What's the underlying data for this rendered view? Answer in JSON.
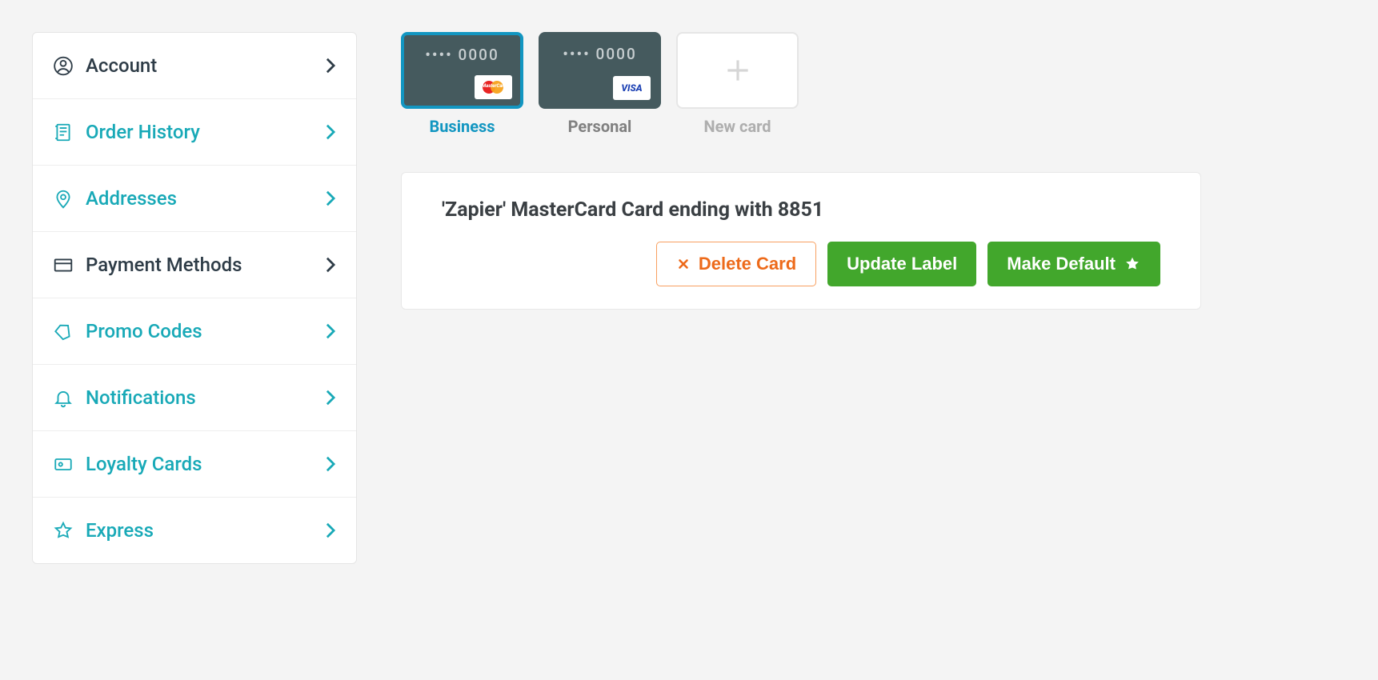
{
  "sidebar": {
    "items": [
      {
        "label": "Account",
        "icon": "user-icon",
        "style": "dark"
      },
      {
        "label": "Order History",
        "icon": "receipt-icon",
        "style": "teal"
      },
      {
        "label": "Addresses",
        "icon": "pin-icon",
        "style": "teal"
      },
      {
        "label": "Payment Methods",
        "icon": "card-icon",
        "style": "dark"
      },
      {
        "label": "Promo Codes",
        "icon": "ticket-icon",
        "style": "teal"
      },
      {
        "label": "Notifications",
        "icon": "bell-icon",
        "style": "teal"
      },
      {
        "label": "Loyalty Cards",
        "icon": "loyalty-icon",
        "style": "teal"
      },
      {
        "label": "Express",
        "icon": "star-outline-icon",
        "style": "teal"
      }
    ]
  },
  "cards": [
    {
      "masked": "•••• 0000",
      "label": "Business",
      "brand": "mastercard",
      "selected": true
    },
    {
      "masked": "•••• 0000",
      "label": "Personal",
      "brand": "visa",
      "selected": false
    }
  ],
  "new_card_label": "New card",
  "visa_text": "VISA",
  "detail": {
    "title": "'Zapier' MasterCard Card ending with 8851",
    "delete_label": "Delete Card",
    "update_label": "Update Label",
    "default_label": "Make Default"
  }
}
